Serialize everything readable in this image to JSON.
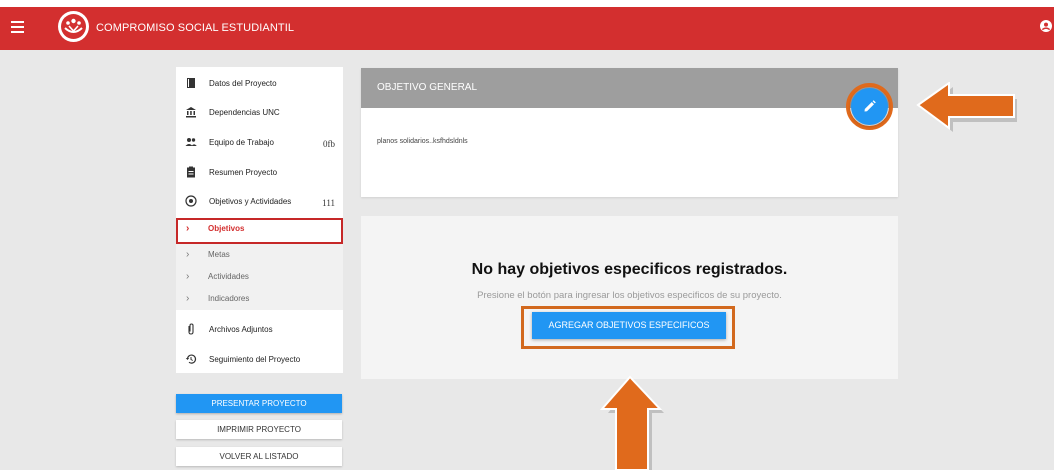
{
  "header": {
    "title": "COMPROMISO SOCIAL ESTUDIANTIL",
    "background": "#d32f2f"
  },
  "sidebar": {
    "items": [
      {
        "label": "Datos del Proyecto",
        "icon": "book-icon",
        "count": ""
      },
      {
        "label": "Dependencias UNC",
        "icon": "institution-icon",
        "count": ""
      },
      {
        "label": "Equipo de Trabajo",
        "icon": "group-icon",
        "count": "0fb"
      },
      {
        "label": "Resumen Proyecto",
        "icon": "clipboard-icon",
        "count": ""
      },
      {
        "label": "Objetivos y Actividades",
        "icon": "target-icon",
        "count": "111"
      }
    ],
    "subitems": [
      {
        "label": "Objetivos",
        "active": true
      },
      {
        "label": "Metas",
        "active": false
      },
      {
        "label": "Actividades",
        "active": false
      },
      {
        "label": "Indicadores",
        "active": false
      }
    ],
    "bottom_items": [
      {
        "label": "Archivos Adjuntos",
        "icon": "paperclip-icon"
      },
      {
        "label": "Seguimiento del Proyecto",
        "icon": "history-icon"
      }
    ]
  },
  "actions": {
    "present": "PRESENTAR PROYECTO",
    "print": "IMPRIMIR PROYECTO",
    "back": "VOLVER AL LISTADO"
  },
  "objective_card": {
    "title": "OBJETIVO GENERAL",
    "text": "planos solidarios..ksfhdsldnls"
  },
  "empty_state": {
    "title": "No hay objetivos especificos registrados.",
    "subtitle": "Presione el botón para ingresar los objetivos especificos de su proyecto.",
    "button": "AGREGAR OBJETIVOS ESPECIFICOS"
  },
  "colors": {
    "accent_blue": "#2196f3",
    "highlight_orange": "#e06a1c",
    "active_red": "#c62828"
  }
}
